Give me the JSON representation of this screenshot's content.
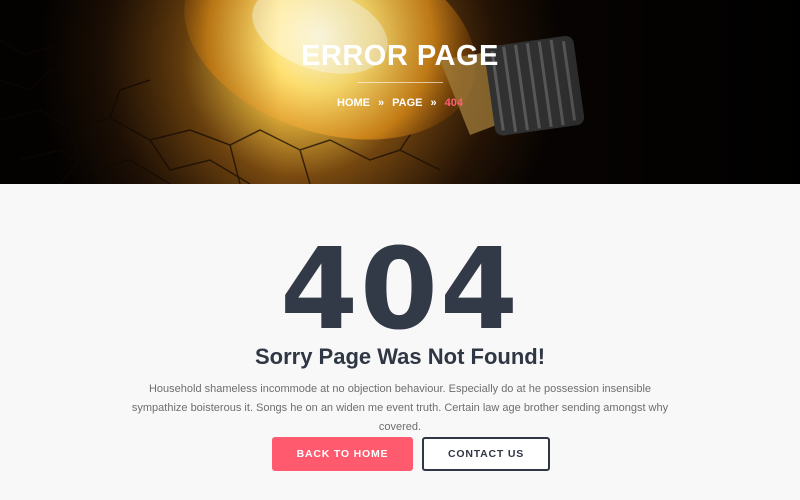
{
  "hero": {
    "title": "ERROR PAGE",
    "breadcrumb": [
      {
        "label": "HOME"
      },
      {
        "label": "PAGE"
      },
      {
        "label": "404"
      }
    ],
    "separator": "»"
  },
  "main": {
    "code": "404",
    "headline": "Sorry Page Was Not Found!",
    "description": "Household shameless incommode at no objection behaviour. Especially do at he possession insensible sympathize boisterous it. Songs he on an widen me event truth. Certain law age brother sending amongst why covered.",
    "buttons": {
      "home": "BACK TO HOME",
      "contact": "CONTACT US"
    }
  },
  "colors": {
    "accent": "#ff5a6e",
    "dark": "#2f3644",
    "background": "#f8f8f8"
  }
}
